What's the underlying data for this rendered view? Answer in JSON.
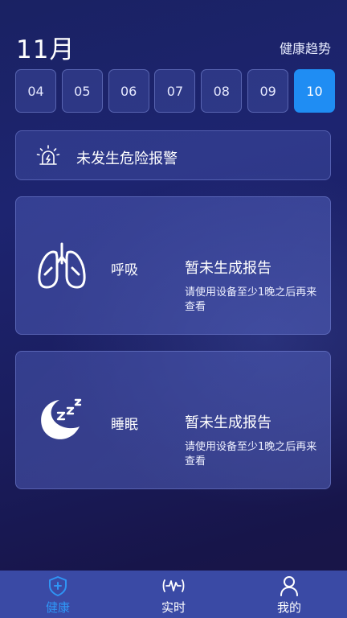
{
  "header": {
    "month": "11月",
    "trend_link": "健康趋势"
  },
  "dates": [
    {
      "label": "04",
      "selected": false
    },
    {
      "label": "05",
      "selected": false
    },
    {
      "label": "06",
      "selected": false
    },
    {
      "label": "07",
      "selected": false
    },
    {
      "label": "08",
      "selected": false
    },
    {
      "label": "09",
      "selected": false
    },
    {
      "label": "10",
      "selected": true
    }
  ],
  "alarm": {
    "icon": "siren-icon",
    "text": "未发生危险报警"
  },
  "breathing": {
    "icon": "lungs-icon",
    "label": "呼吸",
    "status": "暂未生成报告",
    "hint": "请使用设备至少1晚之后再来查看"
  },
  "sleep": {
    "icon": "moon-zzz-icon",
    "label": "睡眠",
    "status": "暂未生成报告",
    "hint": "请使用设备至少1晚之后再来查看"
  },
  "tabs": [
    {
      "label": "健康",
      "icon": "shield-icon",
      "active": true
    },
    {
      "label": "实时",
      "icon": "pulse-wave-icon",
      "active": false
    },
    {
      "label": "我的",
      "icon": "person-icon",
      "active": false
    }
  ],
  "colors": {
    "accent": "#1f8df3",
    "active_tab": "#2f95f5",
    "tabbar": "#3a4aa5"
  }
}
